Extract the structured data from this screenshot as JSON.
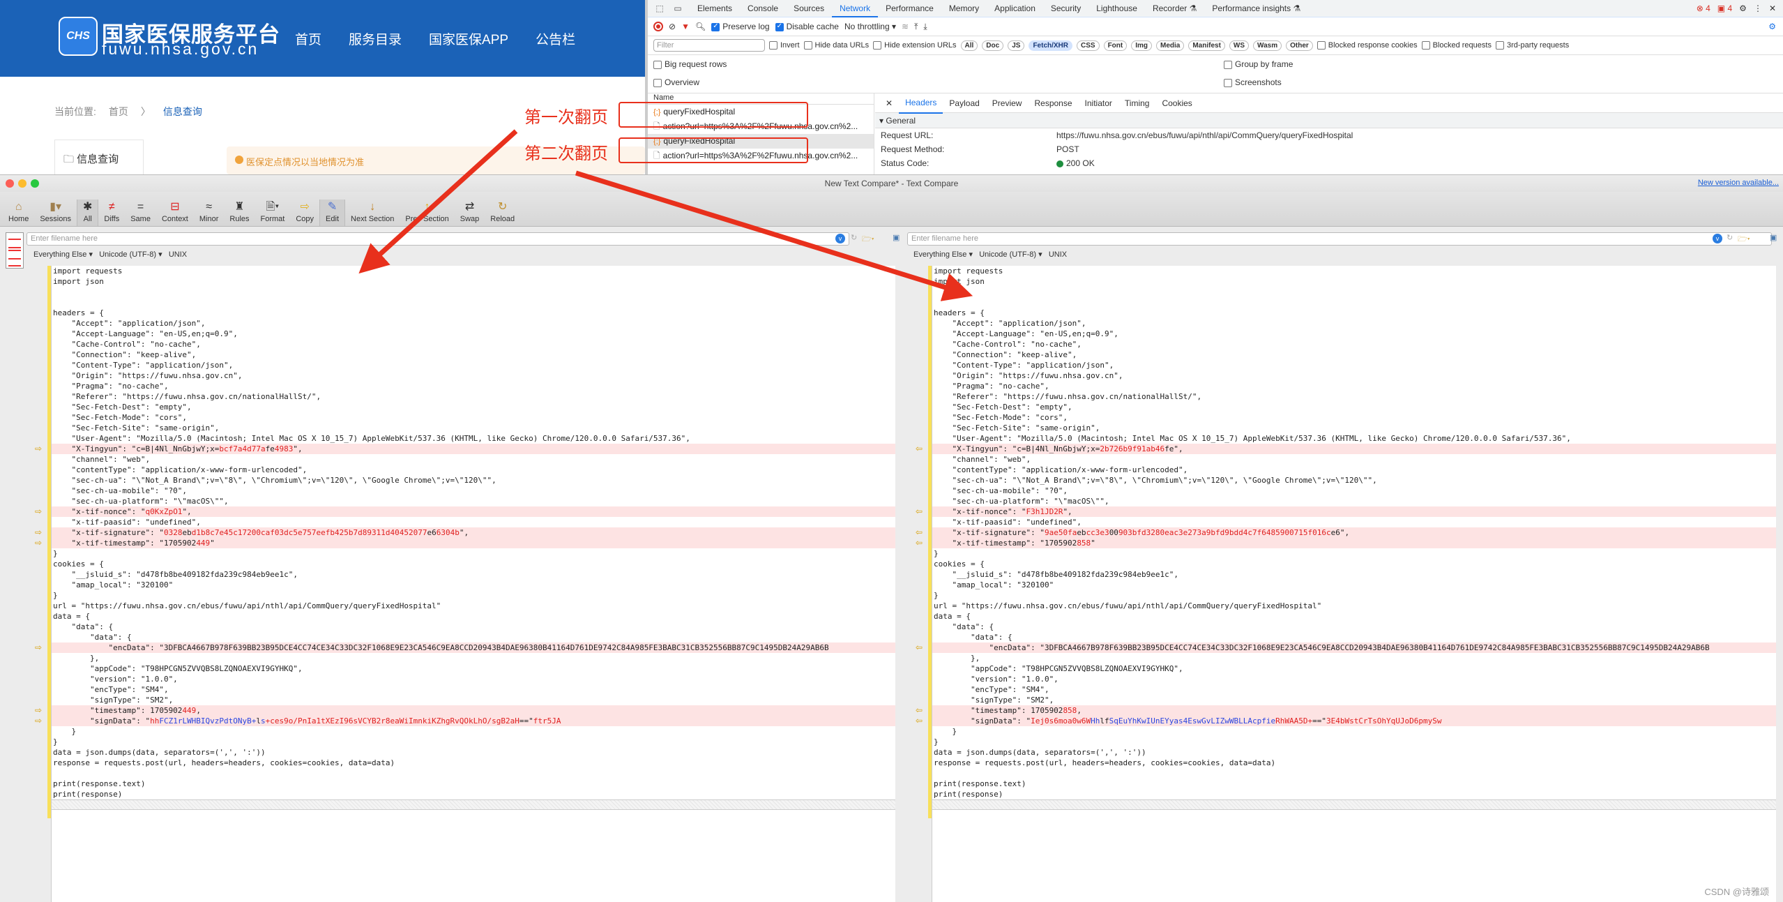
{
  "website": {
    "logo_text": "CHS",
    "title": "国家医保服务平台",
    "domain": "fuwu.nhsa.gov.cn",
    "nav": [
      "首页",
      "服务目录",
      "国家医保APP",
      "公告栏"
    ],
    "breadcrumb": {
      "label": "当前位置:",
      "home": "首页",
      "separator": "〉",
      "current": "信息查询"
    },
    "sidebar_item": "信息查询",
    "notice": "医保定点情况以当地情况为准",
    "colors": {
      "brand": "#1b62b7"
    }
  },
  "devtools": {
    "tabs": [
      "Elements",
      "Console",
      "Sources",
      "Network",
      "Performance",
      "Memory",
      "Application",
      "Security",
      "Lighthouse",
      "Recorder ⚗",
      "Performance insights ⚗"
    ],
    "active_tab": "Network",
    "error_count": "4",
    "issue_count": "4",
    "toolbar": {
      "preserve_log": "Preserve log",
      "disable_cache": "Disable cache",
      "throttling": "No throttling"
    },
    "filter": {
      "placeholder": "Filter",
      "invert": "Invert",
      "hide_data_urls": "Hide data URLs",
      "hide_extension_urls": "Hide extension URLs",
      "types": [
        "All",
        "Doc",
        "JS",
        "Fetch/XHR",
        "CSS",
        "Font",
        "Img",
        "Media",
        "Manifest",
        "WS",
        "Wasm",
        "Other"
      ],
      "active_type": "Fetch/XHR",
      "blocked_response_cookies": "Blocked response cookies",
      "blocked_requests": "Blocked requests",
      "third_party": "3rd-party requests"
    },
    "options": {
      "big_rows": "Big request rows",
      "overview": "Overview",
      "group_by_frame": "Group by frame",
      "screenshots": "Screenshots"
    },
    "requests": {
      "header": "Name",
      "rows": [
        {
          "name": "queryFixedHospital",
          "type": "xhr"
        },
        {
          "name": "action?url=https%3A%2F%2Ffuwu.nhsa.gov.cn%2...",
          "type": "doc"
        },
        {
          "name": "queryFixedHospital",
          "type": "xhr"
        },
        {
          "name": "action?url=https%3A%2F%2Ffuwu.nhsa.gov.cn%2...",
          "type": "doc"
        }
      ]
    },
    "detail": {
      "tabs": [
        "Headers",
        "Payload",
        "Preview",
        "Response",
        "Initiator",
        "Timing",
        "Cookies"
      ],
      "active": "Headers",
      "section": "General",
      "request_url_label": "Request URL:",
      "request_url": "https://fuwu.nhsa.gov.cn/ebus/fuwu/api/nthl/api/CommQuery/queryFixedHospital",
      "method_label": "Request Method:",
      "method": "POST",
      "status_label": "Status Code:",
      "status": "200 OK"
    }
  },
  "annotations": {
    "first": "第一次翻页",
    "second": "第二次翻页",
    "color": "#e8301c"
  },
  "compare": {
    "title": "New Text Compare* - Text Compare",
    "new_version": "New version available...",
    "toolbar": [
      "Home",
      "Sessions",
      "All",
      "Diffs",
      "Same",
      "Context",
      "Minor",
      "Rules",
      "Format",
      "Copy",
      "Edit",
      "Next Section",
      "Prev Section",
      "Swap",
      "Reload"
    ],
    "filename_placeholder": "Enter filename here",
    "format": {
      "type": "Everything Else",
      "encoding": "Unicode (UTF-8)",
      "eol": "UNIX"
    },
    "left_lines": [
      {
        "t": "import requests"
      },
      {
        "t": "import json"
      },
      {
        "t": ""
      },
      {
        "t": ""
      },
      {
        "t": "headers = {"
      },
      {
        "t": "    \"Accept\": \"application/json\","
      },
      {
        "t": "    \"Accept-Language\": \"en-US,en;q=0.9\","
      },
      {
        "t": "    \"Cache-Control\": \"no-cache\","
      },
      {
        "t": "    \"Connection\": \"keep-alive\","
      },
      {
        "t": "    \"Content-Type\": \"application/json\","
      },
      {
        "t": "    \"Origin\": \"https://fuwu.nhsa.gov.cn\","
      },
      {
        "t": "    \"Pragma\": \"no-cache\","
      },
      {
        "t": "    \"Referer\": \"https://fuwu.nhsa.gov.cn/nationalHallSt/\","
      },
      {
        "t": "    \"Sec-Fetch-Dest\": \"empty\","
      },
      {
        "t": "    \"Sec-Fetch-Mode\": \"cors\","
      },
      {
        "t": "    \"Sec-Fetch-Site\": \"same-origin\","
      },
      {
        "t": "    \"User-Agent\": \"Mozilla/5.0 (Macintosh; Intel Mac OS X 10_15_7) AppleWebKit/537.36 (KHTML, like Gecko) Chrome/120.0.0.0 Safari/537.36\","
      },
      {
        "t": "    \"X-Tingyun\": \"c=B|4Nl_NnGbjwY;x=",
        "d": "bcf7a4d77a",
        "t2": "fe",
        "d2": "4983",
        "t3": "\",",
        "diff": true
      },
      {
        "t": "    \"channel\": \"web\","
      },
      {
        "t": "    \"contentType\": \"application/x-www-form-urlencoded\","
      },
      {
        "t": "    \"sec-ch-ua\": \"\\\"Not_A Brand\\\";v=\\\"8\\\", \\\"Chromium\\\";v=\\\"120\\\", \\\"Google Chrome\\\";v=\\\"120\\\"\","
      },
      {
        "t": "    \"sec-ch-ua-mobile\": \"?0\","
      },
      {
        "t": "    \"sec-ch-ua-platform\": \"\\\"macOS\\\"\","
      },
      {
        "t": "    \"x-tif-nonce\": \"",
        "d": "q0KxZpO1",
        "t2": "\",",
        "diff": true
      },
      {
        "t": "    \"x-tif-paasid\": \"undefined\","
      },
      {
        "t": "    \"x-tif-signature\": \"",
        "d": "0328",
        "t2": "eb",
        "d2": "d1b8c7e45c17200caf03dc5e757eefb425b7d89311d40452077",
        "t3": "e6",
        "d3": "6304b",
        "t4": "\",",
        "diff": true
      },
      {
        "t": "    \"x-tif-timestamp\": \"1705902",
        "d": "449",
        "t2": "\"",
        "diff": true
      },
      {
        "t": "}"
      },
      {
        "t": "cookies = {"
      },
      {
        "t": "    \"__jsluid_s\": \"d478fb8be409182fda239c984eb9ee1c\","
      },
      {
        "t": "    \"amap_local\": \"320100\""
      },
      {
        "t": "}"
      },
      {
        "t": "url = \"https://fuwu.nhsa.gov.cn/ebus/fuwu/api/nthl/api/CommQuery/queryFixedHospital\""
      },
      {
        "t": "data = {"
      },
      {
        "t": "    \"data\": {"
      },
      {
        "t": "        \"data\": {"
      },
      {
        "t": "            \"encData\": \"3DFBCA4667B978F639BB23B95DCE4CC74CE34C33DC32F1068E9E23CA546C9EA8CCD20943B4DAE96380B41164D761DE9742C84A985FE3BABC31CB352556BB87C9C1495DB24A29AB6B",
        "diff": true
      },
      {
        "t": "        },"
      },
      {
        "t": "        \"appCode\": \"T98HPCGN5ZVVQBS8LZQNOAEXVI9GYHKQ\","
      },
      {
        "t": "        \"version\": \"1.0.0\","
      },
      {
        "t": "        \"encType\": \"SM4\","
      },
      {
        "t": "        \"signType\": \"SM2\","
      },
      {
        "t": "        \"timestamp\": 1705902",
        "d": "449",
        "t2": ",",
        "diff": true
      },
      {
        "t": "        \"signData\": \"",
        "d": "hh",
        "b": "FCZ1rLWHBIQvzPdtONyB+",
        "b2": "s",
        "d2": "+ces9o/PnIa1tXEzI96sVCYB2r8eaWiImnkiKZhgRvQOkLhO/sgB2aH",
        "t2": "l",
        "d3": "ftr5JA",
        "t3": "==\"",
        "diff": true
      },
      {
        "t": "    }"
      },
      {
        "t": "}"
      },
      {
        "t": "data = json.dumps(data, separators=(',', ':'))"
      },
      {
        "t": "response = requests.post(url, headers=headers, cookies=cookies, data=data)"
      },
      {
        "t": ""
      },
      {
        "t": "print(response.text)"
      },
      {
        "t": "print(response)"
      }
    ],
    "right_lines": [
      {
        "t": "import requests"
      },
      {
        "t": "import json"
      },
      {
        "t": ""
      },
      {
        "t": ""
      },
      {
        "t": "headers = {"
      },
      {
        "t": "    \"Accept\": \"application/json\","
      },
      {
        "t": "    \"Accept-Language\": \"en-US,en;q=0.9\","
      },
      {
        "t": "    \"Cache-Control\": \"no-cache\","
      },
      {
        "t": "    \"Connection\": \"keep-alive\","
      },
      {
        "t": "    \"Content-Type\": \"application/json\","
      },
      {
        "t": "    \"Origin\": \"https://fuwu.nhsa.gov.cn\","
      },
      {
        "t": "    \"Pragma\": \"no-cache\","
      },
      {
        "t": "    \"Referer\": \"https://fuwu.nhsa.gov.cn/nationalHallSt/\","
      },
      {
        "t": "    \"Sec-Fetch-Dest\": \"empty\","
      },
      {
        "t": "    \"Sec-Fetch-Mode\": \"cors\","
      },
      {
        "t": "    \"Sec-Fetch-Site\": \"same-origin\","
      },
      {
        "t": "    \"User-Agent\": \"Mozilla/5.0 (Macintosh; Intel Mac OS X 10_15_7) AppleWebKit/537.36 (KHTML, like Gecko) Chrome/120.0.0.0 Safari/537.36\","
      },
      {
        "t": "    \"X-Tingyun\": \"c=B|4Nl_NnGbjwY;x=",
        "d": "2b726b9f91ab46",
        "t2": "fe\",",
        "diff": true
      },
      {
        "t": "    \"channel\": \"web\","
      },
      {
        "t": "    \"contentType\": \"application/x-www-form-urlencoded\","
      },
      {
        "t": "    \"sec-ch-ua\": \"\\\"Not_A Brand\\\";v=\\\"8\\\", \\\"Chromium\\\";v=\\\"120\\\", \\\"Google Chrome\\\";v=\\\"120\\\"\","
      },
      {
        "t": "    \"sec-ch-ua-mobile\": \"?0\","
      },
      {
        "t": "    \"sec-ch-ua-platform\": \"\\\"macOS\\\"\","
      },
      {
        "t": "    \"x-tif-nonce\": \"",
        "d": "F3h1JD2R",
        "t2": "\",",
        "diff": true
      },
      {
        "t": "    \"x-tif-paasid\": \"undefined\","
      },
      {
        "t": "    \"x-tif-signature\": \"",
        "d": "9ae50fa",
        "t2": "eb",
        "d2": "cc3e3",
        "t3": "00",
        "d3": "903bfd3280eac3e273a9bfd9bdd4c7f6485900715f016c",
        "t4": "e6\",",
        "diff": true
      },
      {
        "t": "    \"x-tif-timestamp\": \"1705902",
        "d": "858",
        "t2": "\"",
        "diff": true
      },
      {
        "t": "}"
      },
      {
        "t": "cookies = {"
      },
      {
        "t": "    \"__jsluid_s\": \"d478fb8be409182fda239c984eb9ee1c\","
      },
      {
        "t": "    \"amap_local\": \"320100\""
      },
      {
        "t": "}"
      },
      {
        "t": "url = \"https://fuwu.nhsa.gov.cn/ebus/fuwu/api/nthl/api/CommQuery/queryFixedHospital\""
      },
      {
        "t": "data = {"
      },
      {
        "t": "    \"data\": {"
      },
      {
        "t": "        \"data\": {"
      },
      {
        "t": "            \"encData\": \"3DFBCA4667B978F639BB23B95DCE4CC74CE34C33DC32F1068E9E23CA546C9EA8CCD20943B4DAE96380B41164D761DE9742C84A985FE3BABC31CB352556BB87C9C1495DB24A29AB6B",
        "diff": true
      },
      {
        "t": "        },"
      },
      {
        "t": "        \"appCode\": \"T98HPCGN5ZVVQBS8LZQNOAEXVI9GYHKQ\","
      },
      {
        "t": "        \"version\": \"1.0.0\","
      },
      {
        "t": "        \"encType\": \"SM4\","
      },
      {
        "t": "        \"signType\": \"SM2\","
      },
      {
        "t": "        \"timestamp\": 1705902",
        "d": "858",
        "t2": ",",
        "diff": true
      },
      {
        "t": "        \"signData\": \"",
        "d": "Iej0s6moa0w6W",
        "b": "Hh",
        "d2": "RhWAA5D+",
        "b2": "SqEuYhKwIUnEYyas4EswGvLIZwWBLLAcpfie",
        "t2": "lf",
        "d3": "3E4bWstCrTsOhYqUJoD6pmySw",
        "t3": "==\"",
        "diff": true
      },
      {
        "t": "    }"
      },
      {
        "t": "}"
      },
      {
        "t": "data = json.dumps(data, separators=(',', ':'))"
      },
      {
        "t": "response = requests.post(url, headers=headers, cookies=cookies, data=data)"
      },
      {
        "t": ""
      },
      {
        "t": "print(response.text)"
      },
      {
        "t": "print(response)"
      }
    ]
  },
  "watermark": "CSDN @诗雅颂"
}
